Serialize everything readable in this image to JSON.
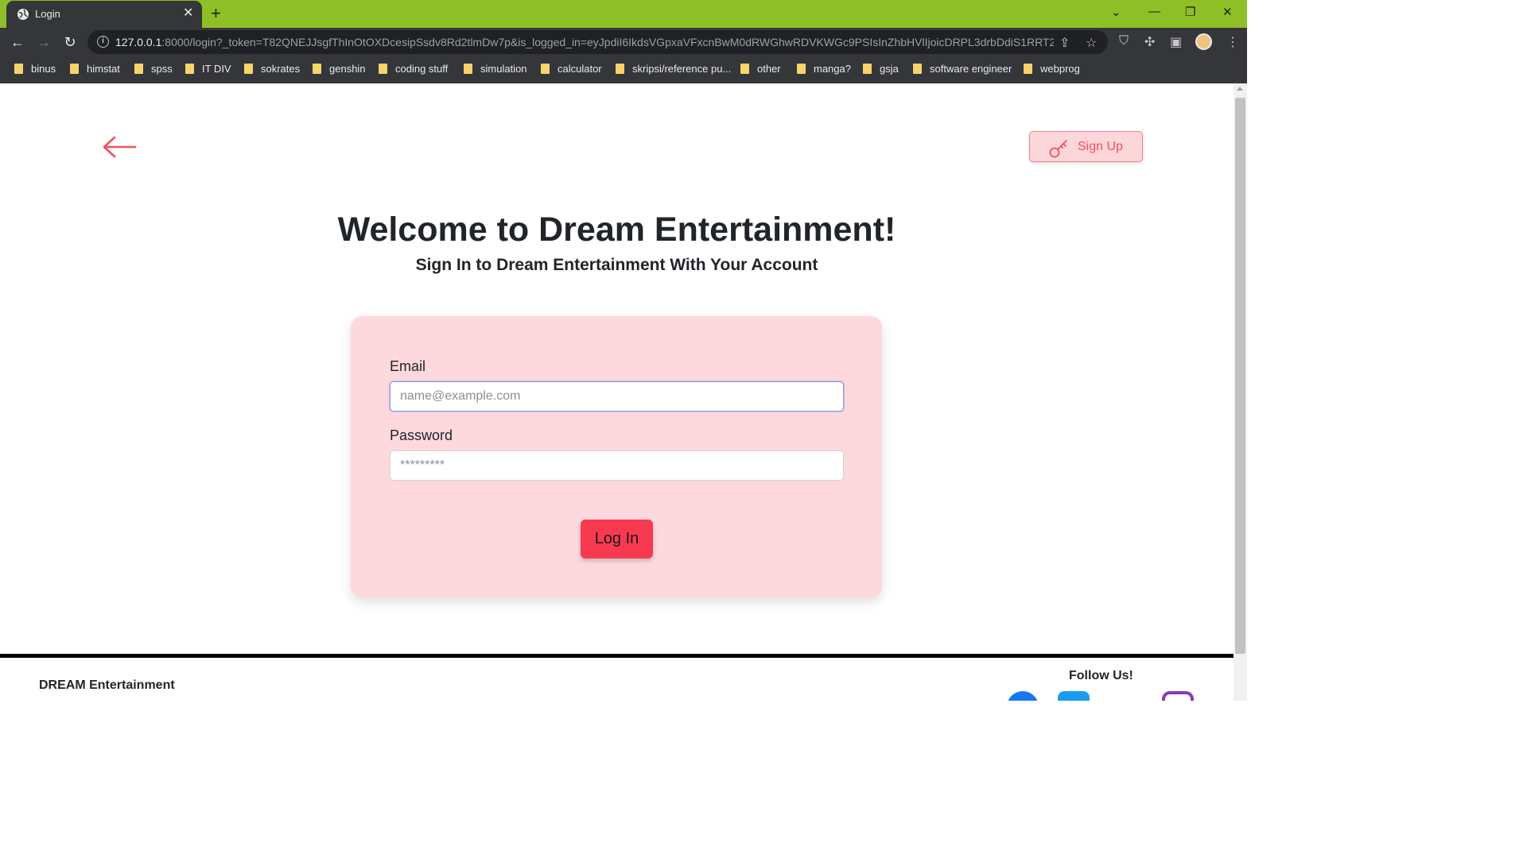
{
  "browser": {
    "tab_title": "Login",
    "tab_close": "✕",
    "new_tab": "+",
    "url_host": "127.0.0.1",
    "url_rest": ":8000/login?_token=T82QNEJJsgfThInOtOXDcesipSsdv8Rd2tlmDw7p&is_logged_in=eyJpdiI6IkdsVGpxaVFxcnBwM0dRWGhwRDVKWGc9PSIsInZhbHVlIjoicDRPL3drbDdiS1RRT24...",
    "bookmarks": [
      "binus",
      "himstat",
      "spss",
      "IT DIV",
      "sokrates",
      "genshin",
      "coding stuff",
      "simulation",
      "calculator",
      "skripsi/reference pu...",
      "other",
      "manga?",
      "gsja",
      "software engineer",
      "webprog"
    ],
    "icons": [
      "back-icon",
      "forward-icon",
      "reload-icon",
      "info-icon",
      "share-icon",
      "star-icon",
      "shield-icon",
      "extensions-icon",
      "side-panel-icon",
      "menu-icon"
    ]
  },
  "page": {
    "back_icon": "arrow-left-icon",
    "signup_label": "Sign Up",
    "signup_icon": "key-icon",
    "title": "Welcome to Dream Entertainment!",
    "subtitle": "Sign In to Dream Entertainment With Your Account",
    "form": {
      "email_label": "Email",
      "email_placeholder": "name@example.com",
      "email_value": "",
      "password_label": "Password",
      "password_placeholder": "*********",
      "password_value": "",
      "submit_label": "Log In"
    },
    "footer": {
      "brand": "DREAM Entertainment",
      "follow": "Follow Us!",
      "social_icons": [
        "facebook-icon",
        "twitter-icon",
        "instagram-icon"
      ]
    }
  },
  "colors": {
    "chrome_accent": "#8fbf26",
    "card_bg": "#fdd8dc",
    "primary_button": "#f83a51",
    "accent_red": "#f0505f"
  }
}
